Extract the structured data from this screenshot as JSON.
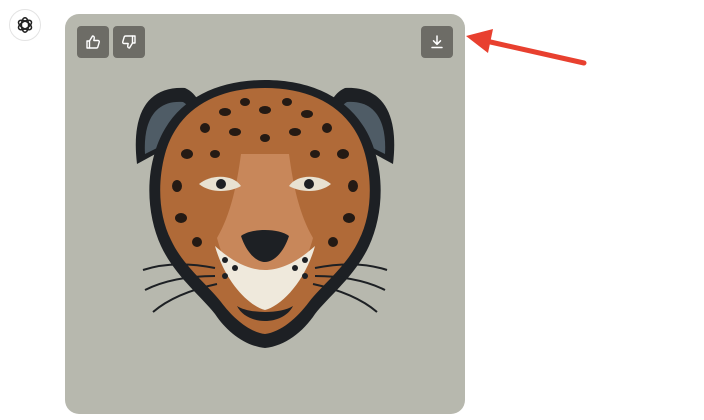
{
  "assistant": {
    "avatar_icon": "openai-logo-icon"
  },
  "image": {
    "subject": "jaguar-head-illustration",
    "background_color": "#b7b8ae",
    "actions": {
      "like_icon": "thumbs-up-icon",
      "dislike_icon": "thumbs-down-icon",
      "download_icon": "download-icon"
    }
  },
  "annotation": {
    "icon": "red-arrow-icon",
    "color": "#e8402f"
  }
}
